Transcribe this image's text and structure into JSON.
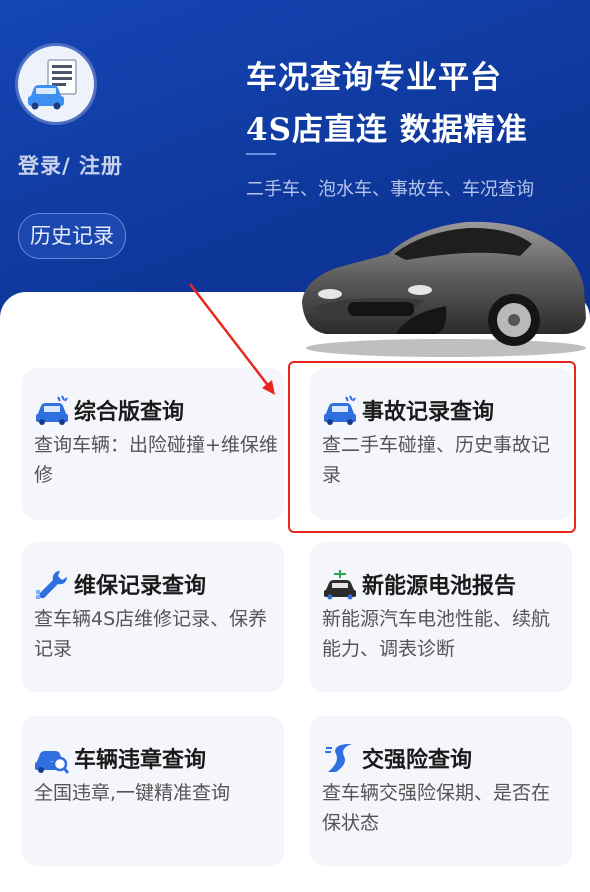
{
  "header": {
    "login_label": "登录/ 注册",
    "history_label": "历史记录",
    "title_line1": "车况查询专业平台",
    "title_line2": "4S店直连 数据精准",
    "subtitle": "二手车、泡水车、事故车、车况查询"
  },
  "colors": {
    "header_blue": "#0f3aa0",
    "card_bg": "#f4f6fb",
    "highlight_red": "#e8281e",
    "icon_blue": "#2f6fe0"
  },
  "cards": [
    {
      "title": "综合版查询",
      "desc": "查询车辆：出险碰撞+维保维修",
      "icon": "car-collision-icon"
    },
    {
      "title": "事故记录查询",
      "desc": "查二手车碰撞、历史事故记录",
      "icon": "car-accident-icon"
    },
    {
      "title": "维保记录查询",
      "desc": "查车辆4S店维修记录、保养记录",
      "icon": "wrench-icon"
    },
    {
      "title": "新能源电池报告",
      "desc": "新能源汽车电池性能、续航能力、调表诊断",
      "icon": "ev-car-icon"
    },
    {
      "title": "车辆违章查询",
      "desc": "全国违章,一键精准查询",
      "icon": "car-search-icon"
    },
    {
      "title": "交强险查询",
      "desc": "查车辆交强险保期、是否在保状态",
      "icon": "road-icon"
    }
  ]
}
